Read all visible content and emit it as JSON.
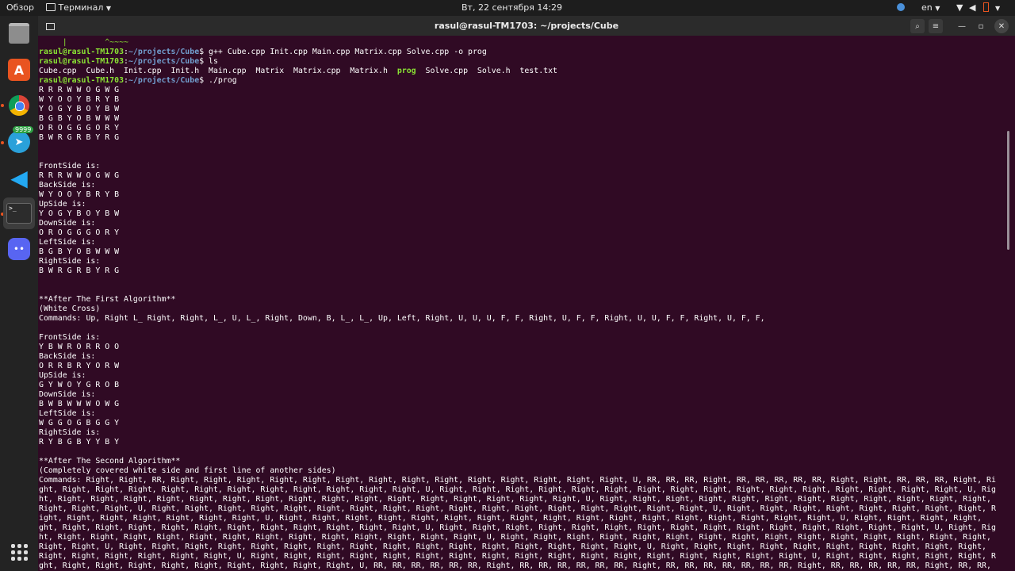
{
  "topbar": {
    "activities": "Обзор",
    "app_menu": "Терминал",
    "clock": "Вт, 22 сентября  14:29",
    "lang": "en"
  },
  "window": {
    "title": "rasul@rasul-TM1703: ~/projects/Cube"
  },
  "dock": {
    "telegram_badge": "9999"
  },
  "terminal": {
    "prompt_user": "rasul@rasul-TM1703",
    "prompt_path": "~/projects/Cube",
    "first_line": "     |        ^~~~~",
    "lines": [
      "R R R W W O G W G",
      "W Y O O Y B R Y B",
      "Y O G Y B O Y B W",
      "B G B Y O B W W W",
      "O R O G G G O R Y",
      "B W R G R B Y R G",
      "",
      "",
      "FrontSide is:",
      "R R R W W O G W G",
      "BackSide is:",
      "W Y O O Y B R Y B",
      "UpSide is:",
      "Y O G Y B O Y B W",
      "DownSide is:",
      "O R O G G G O R Y",
      "LeftSide is:",
      "B G B Y O B W W W",
      "RightSide is:",
      "B W R G R B Y R G",
      "",
      "",
      "**After The First Algorithm**",
      "(White Cross)",
      "Commands: Up, Right L_ Right, Right, L_, U, L_, Right, Down, B, L_, L_, Up, Left, Right, U, U, U, F, F, Right, U, F, F, Right, U, U, F, F, Right, U, F, F,",
      "",
      "FrontSide is:",
      "Y B W R O R R O O",
      "BackSide is:",
      "O R R B R Y O R W",
      "UpSide is:",
      "G Y W O Y G R O B",
      "DownSide is:",
      "B W B W W W O W G",
      "LeftSide is:",
      "W G G O G B G G Y",
      "RightSide is:",
      "R Y B G B Y Y B Y",
      "",
      "**After The Second Algorithm**",
      "(Completely covered white side and first line of another sides)",
      "Commands: Right, Right, RR, Right, Right, Right, Right, Right, Right, Right, Right, Right, Right, Right, Right, Right, Right, U, RR, RR, RR, Right, RR, RR, RR, RR, RR, Right, Right, RR, RR, RR, Right, Ri",
      "ght, Right, Right, Right, Right, Right, Right, Right, Right, Right, Right, Right, U, Right, Right, Right, Right, Right, Right, Right, Right, Right, Right, Right, Right, Right, Right, Right, Right, U, Rig",
      "ht, Right, Right, Right, Right, Right, Right, Right, Right, Right, Right, Right, Right, Right, Right, Right, Right, U, Right, Right, Right, Right, Right, Right, Right, Right, Right, Right, Right, Right,",
      "Right, Right, Right, U, Right, Right, Right, Right, Right, Right, Right, Right, Right, Right, Right, Right, Right, Right, Right, Right, Right, U, Right, Right, Right, Right, Right, Right, Right, Right, R",
      "ight, Right, Right, Right, Right, Right, Right, U, Right, Right, Right, Right, Right, Right, Right, Right, Right, Right, Right, Right, Right, Right, Right, Right, Right, U, Right, Right, Right, Right,",
      "ght, Right, Right, Right, Right, Right, Right, Right, Right, Right, Right, Right, U, Right, Right, Right, Right, Right, Right, Right, Right, Right, Right, Right, Right, Right, Right, Right, U, Right, Rig",
      "ht, Right, Right, Right, Right, Right, Right, Right, Right, Right, Right, Right, Right, Right, U, Right, Right, Right, Right, Right, Right, Right, Right, Right, Right, Right, Right, Right, Right, Right,",
      "Right, Right, U, Right, Right, Right, Right, Right, Right, Right, Right, Right, Right, Right, Right, Right, Right, Right, Right, U, Right, Right, Right, Right, Right, Right, Right, Right, Right, Right,",
      "Right, Right, Right, Right, Right, Right, U, Right, Right, Right, Right, Right, Right, Right, Right, Right, Right, Right, Right, Right, Right, Right, Right, Right, U, Right, Right, Right, Right, Right, R",
      "ght, Right, Right, Right, Right, Right, Right, Right, Right, Right, U, RR, RR, RR, RR, RR, RR, Right, RR, RR, RR, RR, RR, RR, Right, RR, RR, RR, RR, RR, RR, RR, Right, RR, RR, RR, RR, RR, Right, RR, RR,"
    ]
  }
}
